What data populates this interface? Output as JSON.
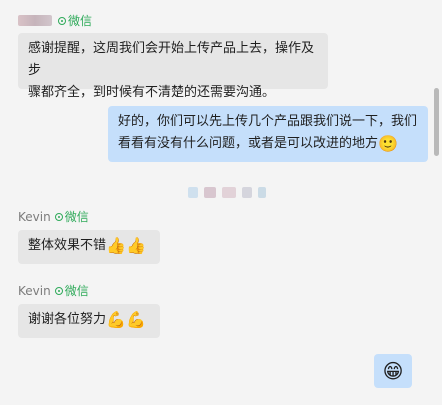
{
  "messages": [
    {
      "side": "left",
      "sender_source": "微信",
      "line1": "感谢提醒，这周我们会开始上传产品上去，操作及步",
      "line2": "骤都齐全，到时候有不清楚的还需要沟通。"
    },
    {
      "side": "right",
      "line1": "好的，你们可以先上传几个产品跟我们说一下，我们",
      "line2": "看看有没有什么问题，或者是可以改进的地方",
      "emoji": "🙂"
    },
    {
      "side": "left",
      "sender_name": "Kevin",
      "sender_source": "微信",
      "text": "整体效果不错",
      "emoji": "👍👍"
    },
    {
      "side": "left",
      "sender_name": "Kevin",
      "sender_source": "微信",
      "text": "谢谢各位努力",
      "emoji": "💪💪"
    },
    {
      "side": "right",
      "emoji": "😁"
    }
  ],
  "colors": {
    "left_bubble": "#e6e6e6",
    "right_bubble": "#c5dffb",
    "wechat_green": "#2faa5a"
  }
}
